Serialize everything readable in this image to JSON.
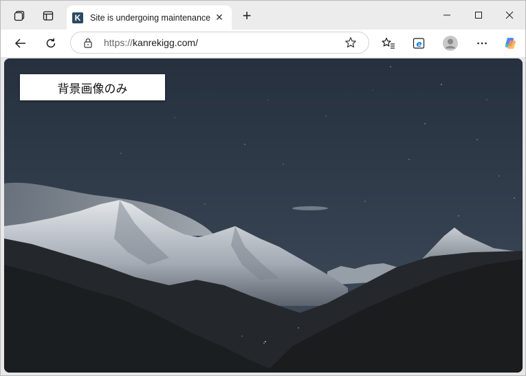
{
  "browser": {
    "tab": {
      "favicon_letter": "K",
      "title": "Site is undergoing maintenance",
      "close_glyph": "✕"
    },
    "new_tab_glyph": "+",
    "address_bar": {
      "url_scheme": "https://",
      "url_host": "kanrekigg.com/"
    }
  },
  "page": {
    "caption": "背景画像のみ",
    "background": "night-mountain-landscape"
  },
  "colors": {
    "tab_strip": "#ececec",
    "toolbar": "#ffffff",
    "sky_top": "#2a3544",
    "sky_bottom": "#3a4553",
    "mountain_dark": "#1d2022"
  },
  "icons": [
    "workspaces-icon",
    "tab-actions-icon",
    "back-icon",
    "refresh-icon",
    "lock-icon",
    "star-icon",
    "favorites-icon",
    "edge-icon",
    "profile-icon",
    "more-icon",
    "copilot-icon",
    "minimize-icon",
    "maximize-icon",
    "close-window-icon"
  ]
}
